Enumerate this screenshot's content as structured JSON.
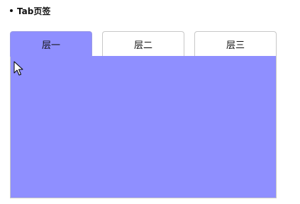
{
  "heading": {
    "title": "Tab页签"
  },
  "tabs": [
    {
      "label": "层一",
      "active": true
    },
    {
      "label": "层二",
      "active": false
    },
    {
      "label": "层三",
      "active": false
    }
  ],
  "colors": {
    "active_tab": "#8f8fff",
    "panel_bg": "#8f8fff",
    "inactive_tab": "#ffffff",
    "border": "#c8c8c8"
  },
  "cursor": {
    "icon": "mouse-pointer-icon"
  }
}
